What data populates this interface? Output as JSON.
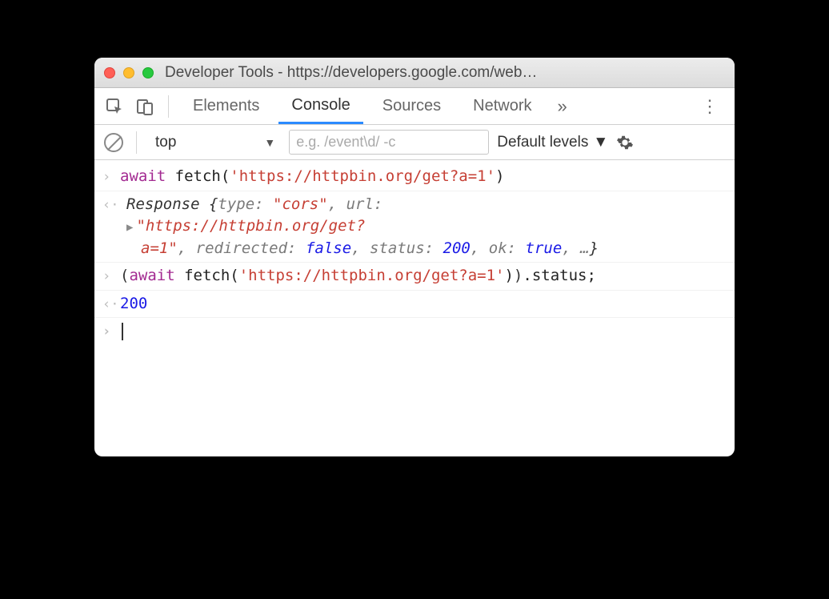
{
  "window": {
    "title": "Developer Tools - https://developers.google.com/web…",
    "traffic": {
      "close": "#ff5f56",
      "min": "#ffbd2e",
      "max": "#27c93f"
    }
  },
  "tabs": {
    "items": [
      "Elements",
      "Console",
      "Sources",
      "Network"
    ],
    "active": "Console",
    "expand": "»"
  },
  "filter": {
    "context": "top",
    "placeholder": "e.g. /event\\d/ -c",
    "levels": "Default levels"
  },
  "console": {
    "entry1": {
      "kw": "await",
      "fn": " fetch(",
      "str": "'https://httpbin.org/get?a=1'",
      "close": ")"
    },
    "resp1": {
      "name": "Response ",
      "open": "{",
      "p1": "type: ",
      "v1": "\"cors\"",
      "c1": ", ",
      "p2": "url: ",
      "v2a": "\"https://httpbin.org/get?",
      "v2b": "a=1\"",
      "c2": ", ",
      "p3": "redirected: ",
      "v3": "false",
      "c3": ", ",
      "p4": "status: ",
      "v4": "200",
      "c4": ", ",
      "p5": "ok: ",
      "v5": "true",
      "c5": ", …",
      "close": "}"
    },
    "entry2": {
      "open": "(",
      "kw": "await",
      "fn": " fetch(",
      "str": "'https://httpbin.org/get?a=1'",
      "close1": ")",
      "close2": ")",
      "prop": ".status;"
    },
    "resp2": "200"
  }
}
